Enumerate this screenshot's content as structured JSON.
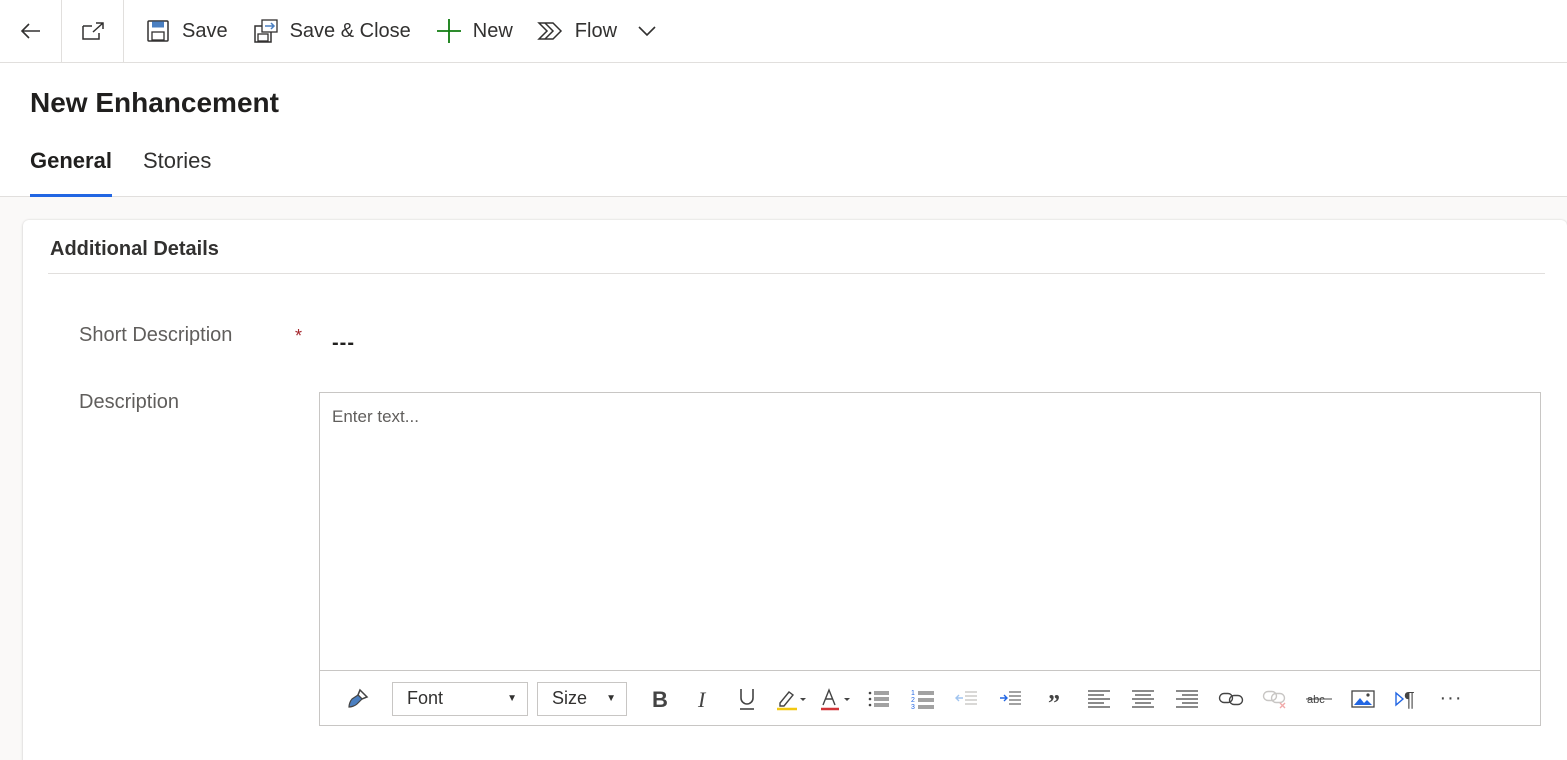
{
  "commandbar": {
    "save_label": "Save",
    "save_close_label": "Save & Close",
    "new_label": "New",
    "flow_label": "Flow"
  },
  "header": {
    "title": "New Enhancement",
    "tabs": [
      {
        "label": "General",
        "active": true
      },
      {
        "label": "Stories",
        "active": false
      }
    ]
  },
  "section": {
    "title": "Additional Details",
    "short_description": {
      "label": "Short Description",
      "required_marker": "*",
      "value": "---"
    },
    "description": {
      "label": "Description",
      "placeholder": "Enter text..."
    }
  },
  "editor_toolbar": {
    "font_label": "Font",
    "size_label": "Size",
    "more_label": "···"
  },
  "colors": {
    "accent": "#2266e3",
    "required": "#a4262c",
    "new_icon": "#107c10"
  }
}
